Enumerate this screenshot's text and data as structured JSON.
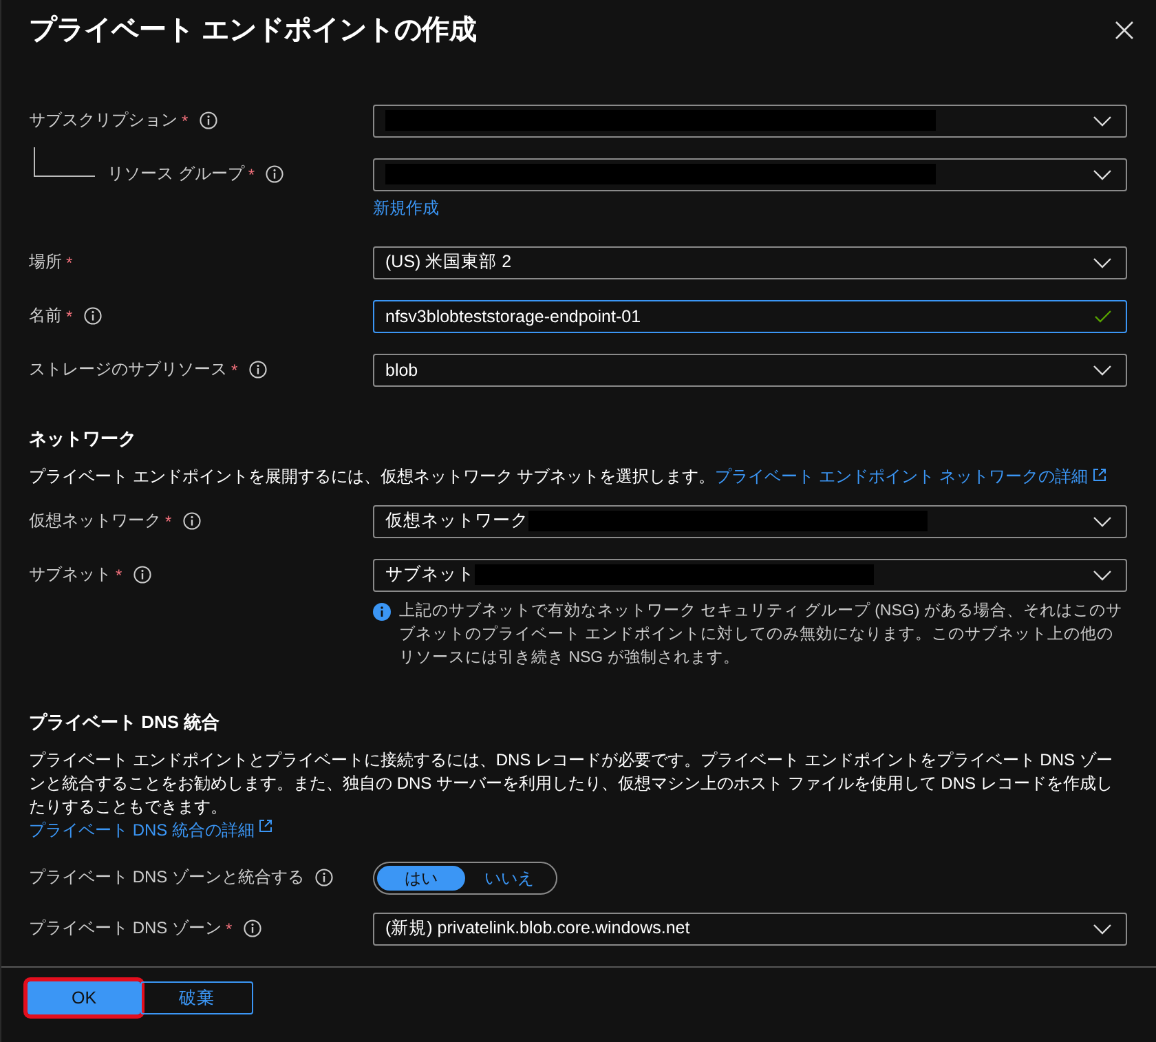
{
  "window": {
    "title": "プライベート エンドポイントの作成"
  },
  "required_mark": "*",
  "sections": [
    {
      "fields": [
        {
          "kind": "dropdown",
          "label": "サブスクリプション",
          "required": true,
          "info": true,
          "nested": false,
          "redacted": true
        },
        {
          "kind": "dropdown",
          "label": "リソース グループ",
          "required": true,
          "info": true,
          "nested": true,
          "redacted": true,
          "link": "新規作成"
        },
        {
          "kind": "dropdown",
          "label": "場所",
          "required": true,
          "info": false,
          "nested": false,
          "redacted": false,
          "value": "(US) 米国東部 2"
        },
        {
          "kind": "textbox",
          "label": "名前",
          "required": true,
          "info": true,
          "nested": false,
          "redacted": false,
          "value": "nfsv3blobteststorage-endpoint-01",
          "focused": true,
          "valid": true
        },
        {
          "kind": "dropdown",
          "label": "ストレージのサブリソース",
          "required": true,
          "info": true,
          "nested": false,
          "redacted": false,
          "value": "blob"
        }
      ]
    },
    {
      "heading": "ネットワーク",
      "description": "プライベート エンドポイントを展開するには、仮想ネットワーク サブネットを選択します。",
      "description_link": "プライベート エンドポイント ネットワークの詳細",
      "fields": [
        {
          "kind": "dropdown",
          "label": "仮想ネットワーク",
          "required": true,
          "info": true,
          "nested": false,
          "redacted": true,
          "value": "仮想ネットワーク"
        },
        {
          "kind": "dropdown",
          "label": "サブネット",
          "required": true,
          "info": true,
          "nested": false,
          "redacted": true,
          "value": "サブネット",
          "note": "上記のサブネットで有効なネットワーク セキュリティ グループ (NSG) がある場合、それはこのサブネットのプライベート エンドポイントに対してのみ無効になります。このサブネット上の他のリソースには引き続き NSG が強制されます。"
        }
      ]
    },
    {
      "heading": "プライベート DNS 統合",
      "description": "プライベート エンドポイントとプライベートに接続するには、DNS レコードが必要です。プライベート エンドポイントをプライベート DNS ゾーンと統合することをお勧めします。また、独自の DNS サーバーを利用したり、仮想マシン上のホスト ファイルを使用して DNS レコードを作成したりすることもできます。",
      "description_link": "プライベート DNS 統合の詳細",
      "link_block": true,
      "fields": [
        {
          "kind": "toggle",
          "label": "プライベート DNS ゾーンと統合する",
          "required": false,
          "info": true,
          "options": [
            {
              "label": "はい",
              "selected": true
            },
            {
              "label": "いいえ",
              "selected": false
            }
          ]
        },
        {
          "kind": "dropdown",
          "label": "プライベート DNS ゾーン",
          "required": true,
          "info": true,
          "nested": false,
          "redacted": false,
          "value": "(新規) privatelink.blob.core.windows.net"
        }
      ]
    }
  ],
  "buttons": [
    {
      "label": "OK",
      "kind": "primary",
      "highlighted": true
    },
    {
      "label": "破棄",
      "kind": "secondary",
      "highlighted": false
    }
  ]
}
